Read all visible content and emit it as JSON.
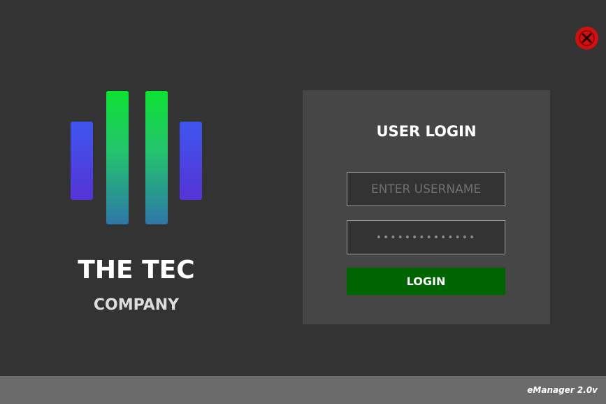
{
  "window": {
    "close_icon": "close-icon",
    "close_color": "#cc1111"
  },
  "brand": {
    "logo_icon": "bars-logo",
    "name": "THE TEC",
    "subtitle": "COMPANY",
    "colors": {
      "outer_bars": "#4a45e6",
      "inner_bars_top": "#0ee133",
      "inner_bars_bottom": "#2f77a8"
    }
  },
  "login": {
    "title": "USER LOGIN",
    "username": {
      "value": "",
      "placeholder": "ENTER USERNAME"
    },
    "password": {
      "masked_value": "••••••••••••••"
    },
    "button_label": "LOGIN",
    "button_color": "#006400",
    "panel_color": "#464646"
  },
  "footer": {
    "version": "eManager 2.0v"
  }
}
